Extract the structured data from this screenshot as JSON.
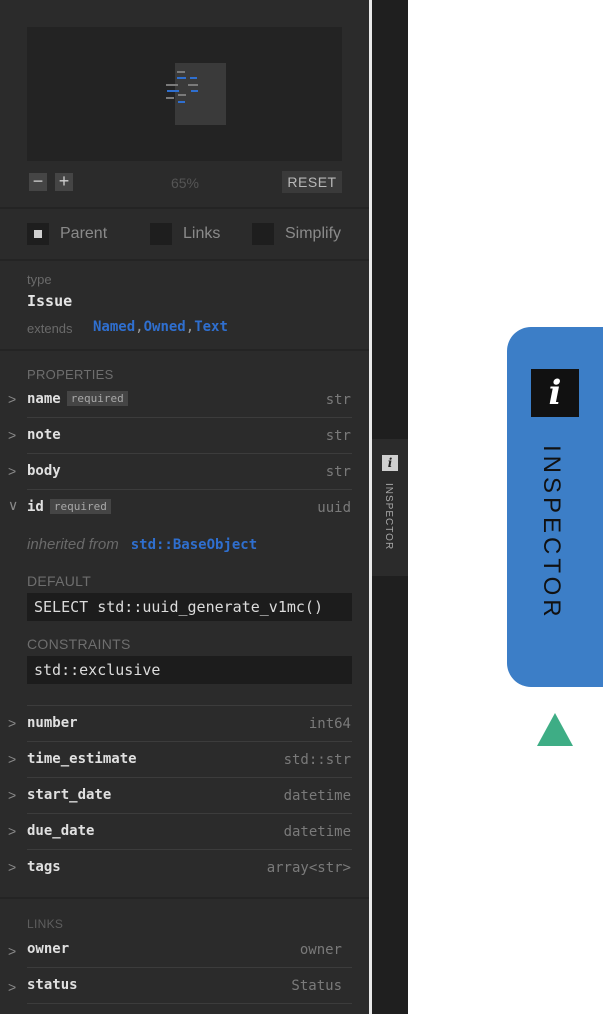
{
  "minimap": {
    "zoom_out_label": "−",
    "zoom_in_label": "+",
    "zoom_level": "65%",
    "reset_label": "RESET"
  },
  "toggles": [
    {
      "label": "Parent",
      "checked": true
    },
    {
      "label": "Links",
      "checked": false
    },
    {
      "label": "Simplify",
      "checked": false
    }
  ],
  "type_info": {
    "type_label": "type",
    "type_name": "Issue",
    "extends_label": "extends",
    "extends": [
      "Named",
      "Owned",
      "Text"
    ],
    "extends_separator": ","
  },
  "properties": {
    "title": "PROPERTIES",
    "items": [
      {
        "name": "name",
        "badge": "required",
        "type": "str"
      },
      {
        "name": "note",
        "type": "str"
      },
      {
        "name": "body",
        "type": "str"
      }
    ],
    "expanded": {
      "name": "id",
      "badge": "required",
      "type": "uuid",
      "inherited_label": "inherited from",
      "inherited_from": "std::BaseObject",
      "default_title": "DEFAULT",
      "default_value": "SELECT std::uuid_generate_v1mc()",
      "constraints_title": "CONSTRAINTS",
      "constraint_value": "std::exclusive"
    },
    "more_items": [
      {
        "name": "number",
        "type": "int64"
      },
      {
        "name": "time_estimate",
        "type": "std::str"
      },
      {
        "name": "start_date",
        "type": "datetime"
      },
      {
        "name": "due_date",
        "type": "datetime"
      },
      {
        "name": "tags",
        "type": "array<str>"
      }
    ]
  },
  "links": {
    "title": "LINKS",
    "items": [
      {
        "name": "owner",
        "type": "owner"
      },
      {
        "name": "status",
        "type": "Status"
      }
    ]
  },
  "side_tab": {
    "icon": "info-icon",
    "icon_glyph": "i",
    "label": "INSPECTOR"
  },
  "callout": {
    "icon": "info-icon",
    "icon_glyph": "i",
    "label": "INSPECTOR"
  },
  "colors": {
    "panel_bg": "#2b2b2b",
    "link_blue": "#2f6fcf",
    "callout_blue": "#3c7ec7",
    "arrow_green": "#3ead85"
  }
}
